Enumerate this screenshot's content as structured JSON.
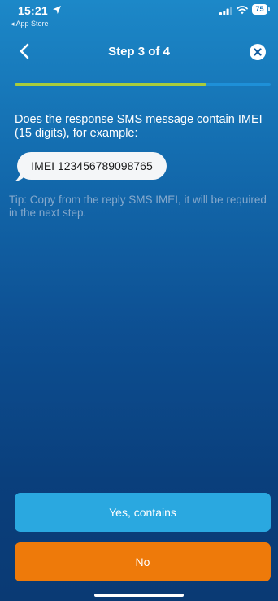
{
  "status_bar": {
    "time": "15:21",
    "back_label": "◂ App Store",
    "battery": "75"
  },
  "nav": {
    "title": "Step 3 of 4",
    "back_icon": "chevron-left-icon",
    "close_icon": "close-circle-icon"
  },
  "progress": {
    "fraction": 0.75,
    "fill_color": "#a8cc3c",
    "track_color": "#1e90d8"
  },
  "content": {
    "question": "Does the response SMS message contain IMEI (15 digits), for example:",
    "sms_example": "IMEI 123456789098765",
    "tip": "Tip: Copy from the reply SMS IMEI, it will be required in the next step."
  },
  "buttons": {
    "yes_label": "Yes, contains",
    "no_label": "No",
    "yes_color": "#2aa8e0",
    "no_color": "#ee7a0a"
  }
}
